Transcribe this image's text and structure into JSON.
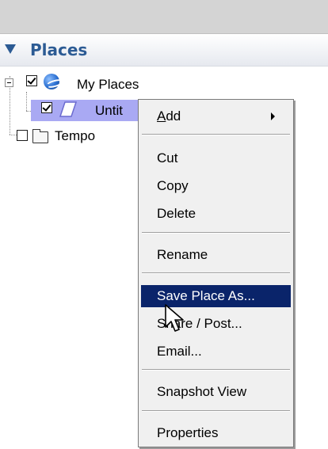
{
  "panel": {
    "title": "Places"
  },
  "tree": {
    "items": [
      {
        "label": "My Places",
        "checked": true,
        "icon": "globe-icon"
      },
      {
        "label": "Untit",
        "checked": true,
        "icon": "polygon-icon",
        "selected": true
      },
      {
        "label": "Tempo",
        "checked": false,
        "icon": "folder-icon"
      }
    ]
  },
  "context_menu": {
    "items": [
      {
        "label": "Add",
        "shortcut_letter": "A",
        "has_submenu": true
      },
      {
        "label": "Cut"
      },
      {
        "label": "Copy"
      },
      {
        "label": "Delete"
      },
      {
        "label": "Rename"
      },
      {
        "label": "Save Place As...",
        "highlighted": true
      },
      {
        "label": "Share / Post..."
      },
      {
        "label": "Email..."
      },
      {
        "label": "Snapshot View"
      },
      {
        "label": "Properties"
      }
    ]
  },
  "colors": {
    "header_text": "#2c5b94",
    "selection_row": "#a9a9f3",
    "menu_highlight": "#0a246a",
    "menu_bg": "#f0f0f0"
  }
}
